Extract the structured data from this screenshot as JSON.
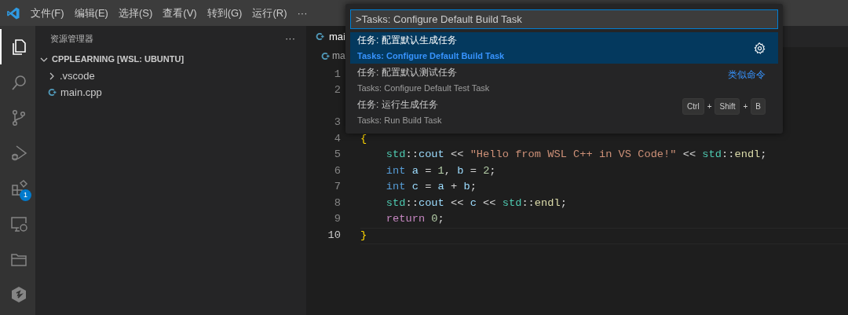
{
  "menu": [
    "文件(F)",
    "编辑(E)",
    "选择(S)",
    "查看(V)",
    "转到(G)",
    "运行(R)",
    "···"
  ],
  "activity_bar": [
    {
      "kind": "files",
      "selected": true
    },
    {
      "kind": "search",
      "selected": false
    },
    {
      "kind": "source-control",
      "selected": false
    },
    {
      "kind": "run-debug",
      "selected": false
    },
    {
      "kind": "extensions",
      "selected": false,
      "badge": "1"
    },
    {
      "kind": "remote",
      "selected": false
    },
    {
      "kind": "folder",
      "selected": false
    },
    {
      "kind": "hexagon",
      "selected": false
    }
  ],
  "sidebar": {
    "title": "资源管理器",
    "more": "···",
    "tree": [
      {
        "label": "CPPLEARNING [WSL: UBUNTU]",
        "expanded": true,
        "children": [
          {
            "label": ".vscode",
            "kind": "folder",
            "expanded": false
          },
          {
            "label": "main.cpp",
            "kind": "cpp"
          }
        ]
      }
    ]
  },
  "editor": {
    "tab": "mai",
    "breadcrumb": "ma",
    "lines": [
      {
        "number": "1",
        "current": false
      },
      {
        "number": "2",
        "current": false
      },
      {
        "number": "3",
        "current": false
      },
      {
        "number": "4",
        "current": false,
        "tokens": [
          {
            "text": "{",
            "kind": "brace"
          }
        ]
      },
      {
        "number": "5",
        "current": false,
        "tokens": [
          {
            "text": "    std",
            "kind": "ns"
          },
          {
            "text": "::",
            "kind": "plain"
          },
          {
            "text": "cout",
            "kind": "var"
          },
          {
            "text": " << ",
            "kind": "plain"
          },
          {
            "text": "\"Hello from WSL C++ in VS Code!\"",
            "kind": "string"
          },
          {
            "text": " << ",
            "kind": "plain"
          },
          {
            "text": "std",
            "kind": "ns"
          },
          {
            "text": "::",
            "kind": "plain"
          },
          {
            "text": "endl",
            "kind": "func"
          },
          {
            "text": ";",
            "kind": "plain"
          }
        ]
      },
      {
        "number": "6",
        "current": false,
        "tokens": [
          {
            "text": "    int ",
            "kind": "type"
          },
          {
            "text": "a",
            "kind": "var"
          },
          {
            "text": " = ",
            "kind": "plain"
          },
          {
            "text": "1",
            "kind": "number"
          },
          {
            "text": ", ",
            "kind": "plain"
          },
          {
            "text": "b",
            "kind": "var"
          },
          {
            "text": " = ",
            "kind": "plain"
          },
          {
            "text": "2",
            "kind": "number"
          },
          {
            "text": ";",
            "kind": "plain"
          }
        ]
      },
      {
        "number": "7",
        "current": false,
        "tokens": [
          {
            "text": "    int ",
            "kind": "type"
          },
          {
            "text": "c",
            "kind": "var"
          },
          {
            "text": " = ",
            "kind": "plain"
          },
          {
            "text": "a",
            "kind": "var"
          },
          {
            "text": " + ",
            "kind": "plain"
          },
          {
            "text": "b",
            "kind": "var"
          },
          {
            "text": ";",
            "kind": "plain"
          }
        ]
      },
      {
        "number": "8",
        "current": false,
        "tokens": [
          {
            "text": "    std",
            "kind": "ns"
          },
          {
            "text": "::",
            "kind": "plain"
          },
          {
            "text": "cout",
            "kind": "var"
          },
          {
            "text": " << ",
            "kind": "plain"
          },
          {
            "text": "c",
            "kind": "var"
          },
          {
            "text": " << ",
            "kind": "plain"
          },
          {
            "text": "std",
            "kind": "ns"
          },
          {
            "text": "::",
            "kind": "plain"
          },
          {
            "text": "endl",
            "kind": "func"
          },
          {
            "text": ";",
            "kind": "plain"
          }
        ]
      },
      {
        "number": "9",
        "current": false,
        "tokens": [
          {
            "text": "    return ",
            "kind": "keyword"
          },
          {
            "text": "0",
            "kind": "number"
          },
          {
            "text": ";",
            "kind": "plain"
          }
        ]
      },
      {
        "number": "10",
        "current": true,
        "tokens": [
          {
            "text": "}",
            "kind": "brace"
          }
        ]
      }
    ]
  },
  "command_palette": {
    "value": ">Tasks: Configure Default Build Task",
    "items": [
      {
        "label": "任务: 配置默认生成任务",
        "detail": "Tasks: Configure Default Build Task",
        "selected": true,
        "gear": true
      },
      {
        "label": "任务: 配置默认测试任务",
        "detail": "Tasks: Configure Default Test Task",
        "selected": false,
        "note": "类似命令"
      },
      {
        "label": "任务: 运行生成任务",
        "detail": "Tasks: Run Build Task",
        "selected": false,
        "keys": [
          "Ctrl",
          "+",
          "Shift",
          "+",
          "B"
        ]
      }
    ]
  }
}
